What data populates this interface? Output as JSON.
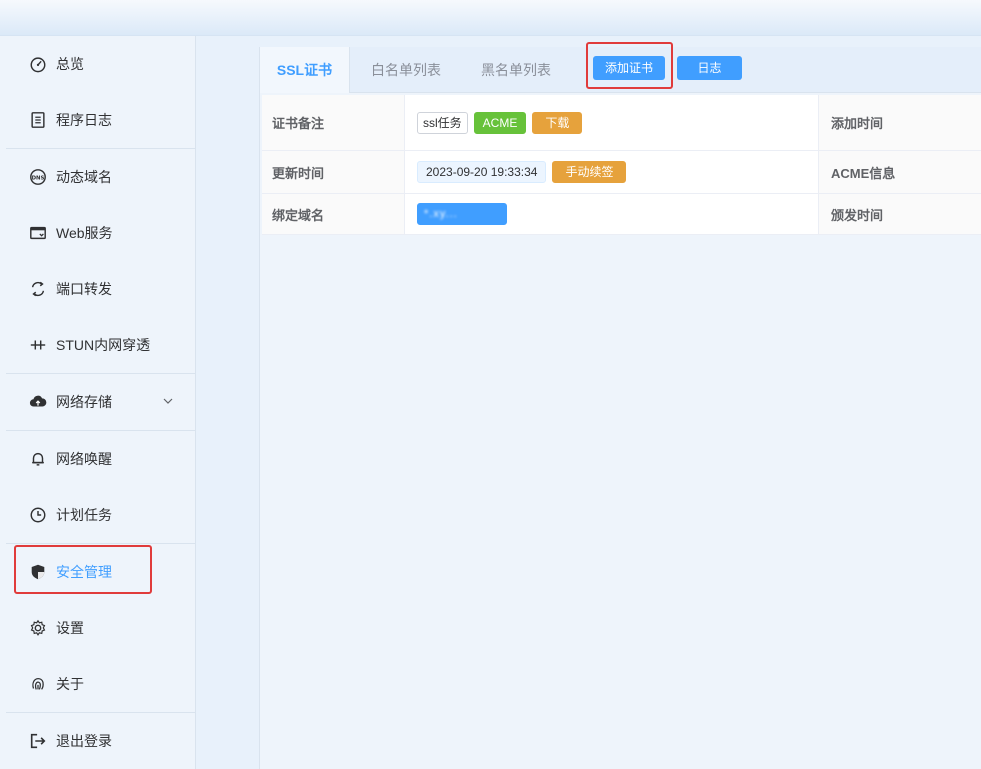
{
  "sidebar": {
    "items": [
      {
        "label": "总览",
        "icon": "dashboard-icon"
      },
      {
        "label": "程序日志",
        "icon": "log-icon"
      },
      {
        "label": "动态域名",
        "icon": "dns-icon"
      },
      {
        "label": "Web服务",
        "icon": "web-service-icon"
      },
      {
        "label": "端口转发",
        "icon": "port-forward-icon"
      },
      {
        "label": "STUN内网穿透",
        "icon": "stun-icon"
      },
      {
        "label": "网络存储",
        "icon": "cloud-upload-icon"
      },
      {
        "label": "网络唤醒",
        "icon": "bell-icon"
      },
      {
        "label": "计划任务",
        "icon": "clock-icon"
      },
      {
        "label": "安全管理",
        "icon": "shield-icon"
      },
      {
        "label": "设置",
        "icon": "gear-icon"
      },
      {
        "label": "关于",
        "icon": "fingerprint-icon"
      },
      {
        "label": "退出登录",
        "icon": "logout-icon"
      }
    ]
  },
  "tabs": [
    {
      "label": "SSL证书"
    },
    {
      "label": "白名单列表"
    },
    {
      "label": "黑名单列表"
    }
  ],
  "toolbar": {
    "add_cert_label": "添加证书",
    "log_label": "日志"
  },
  "cert": {
    "remark_label": "证书备注",
    "remark_tag": "ssl任务",
    "type_tag": "ACME",
    "download_label": "下载",
    "add_time_label": "添加时间",
    "update_time_label": "更新时间",
    "update_time_value": "2023-09-20 19:33:34",
    "renew_label": "手动续签",
    "acme_info_label": "ACME信息",
    "bind_domain_label": "绑定域名",
    "bind_domain_value": "*.xy...",
    "issue_time_label": "颁发时间"
  },
  "colors": {
    "accent": "#409eff",
    "success": "#67c23a",
    "warning": "#e6a23c",
    "highlight_box": "#e03b3b"
  }
}
